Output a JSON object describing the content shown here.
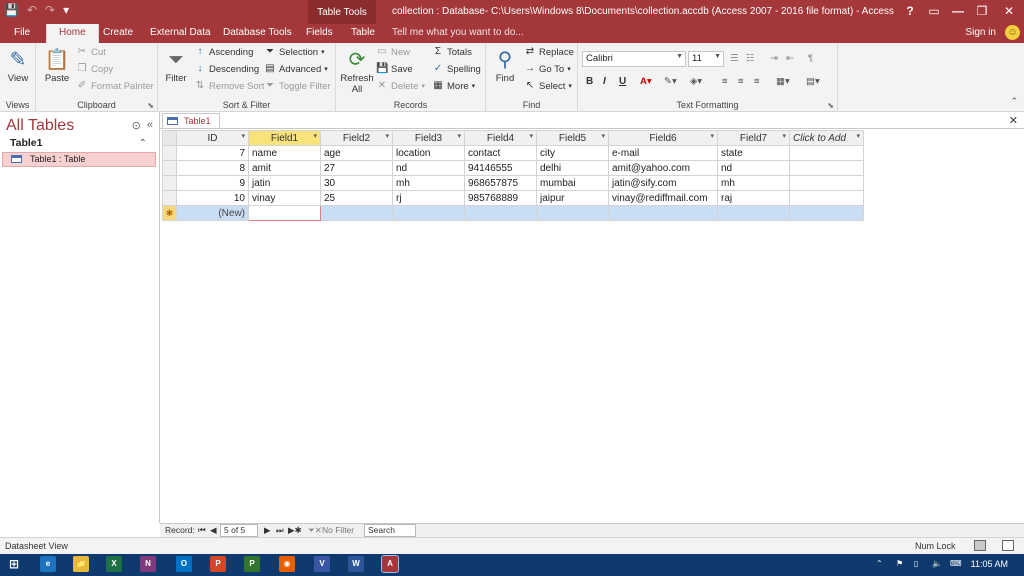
{
  "title_bar": {
    "qat_save": "💾",
    "qat_undo": "↶",
    "qat_redo": "↷",
    "qat_more": "▾",
    "contextual_tab": "Table Tools",
    "window_title": "collection : Database- C:\\Users\\Windows 8\\Documents\\collection.accdb (Access 2007 - 2016 file format) - Access",
    "help": "?",
    "ribbon_display": "▭",
    "minimize": "—",
    "maximize": "❐",
    "close": "✕"
  },
  "tabs": {
    "file": "File",
    "home": "Home",
    "create": "Create",
    "external_data": "External Data",
    "database_tools": "Database Tools",
    "fields": "Fields",
    "table": "Table",
    "tell_me": "Tell me what you want to do...",
    "sign_in": "Sign in",
    "user_icon": "☺"
  },
  "ribbon": {
    "views": {
      "view": "View",
      "label": "Views"
    },
    "clipboard": {
      "paste": "Paste",
      "cut": "Cut",
      "copy": "Copy",
      "format_painter": "Format Painter",
      "label": "Clipboard"
    },
    "sort_filter": {
      "filter": "Filter",
      "ascending": "Ascending",
      "descending": "Descending",
      "remove_sort": "Remove Sort",
      "selection": "Selection",
      "advanced": "Advanced",
      "toggle_filter": "Toggle Filter",
      "label": "Sort & Filter"
    },
    "records": {
      "refresh_all": "Refresh",
      "refresh_all_2": "All",
      "new": "New",
      "save": "Save",
      "delete": "Delete",
      "totals": "Totals",
      "spelling": "Spelling",
      "more": "More",
      "label": "Records"
    },
    "find": {
      "find": "Find",
      "replace": "Replace",
      "goto": "Go To",
      "select": "Select",
      "label": "Find"
    },
    "text_formatting": {
      "font": "Calibri",
      "size": "11",
      "bold": "B",
      "italic": "I",
      "underline": "U",
      "label": "Text Formatting"
    }
  },
  "nav_pane": {
    "title": "All Tables",
    "group": "Table1",
    "item": "Table1 : Table"
  },
  "document": {
    "tab": "Table1",
    "close": "✕"
  },
  "datasheet": {
    "columns": [
      "ID",
      "Field1",
      "Field2",
      "Field3",
      "Field4",
      "Field5",
      "Field6",
      "Field7",
      "Click to Add"
    ],
    "rows": [
      [
        "7",
        "name",
        "age",
        "location",
        "contact",
        "city",
        "e-mail",
        "state"
      ],
      [
        "8",
        "amit",
        "27",
        "nd",
        "94146555",
        "delhi",
        "amit@yahoo.com",
        "nd"
      ],
      [
        "9",
        "jatin",
        "30",
        "mh",
        "968657875",
        "mumbai",
        "jatin@sify.com",
        "mh"
      ],
      [
        "10",
        "vinay",
        "25",
        "rj",
        "985768889",
        "jaipur",
        "vinay@rediffmail.com",
        "raj"
      ]
    ],
    "new_row_label": "(New)",
    "new_row_marker": "✱"
  },
  "record_nav": {
    "label": "Record:",
    "first": "⏮",
    "prev": "◀",
    "position": "5 of 5",
    "next": "▶",
    "last": "⏭",
    "new": "▶✱",
    "no_filter": "No Filter",
    "search": "Search"
  },
  "status_bar": {
    "view": "Datasheet View",
    "num_lock": "Num Lock"
  },
  "taskbar": {
    "time": "11:05 AM",
    "apps": [
      "e",
      "📁",
      "X",
      "N",
      "O",
      "P",
      "P",
      "◉",
      "V",
      "W",
      "A"
    ]
  },
  "colors": {
    "accent": "#a4373a",
    "selected_header": "#f8e37a",
    "new_row": "#c9def5"
  }
}
